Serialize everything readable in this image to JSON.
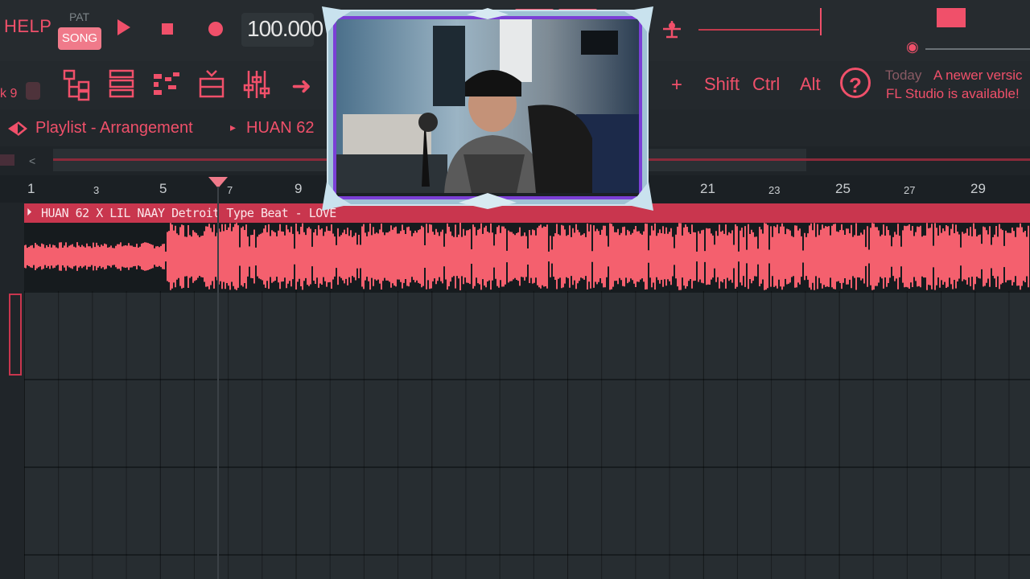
{
  "transport": {
    "help_label": "HELP",
    "pat_label": "PAT",
    "song_label": "SONG",
    "tempo": "100.000",
    "accent_color": "#f0506a"
  },
  "toolbar": {
    "pattern_num": "k 9",
    "shift_label": "Shift",
    "ctrl_label": "Ctrl",
    "alt_label": "Alt",
    "plus_label": "+",
    "icons": [
      "playlist-icon",
      "channel-rack-icon",
      "piano-roll-icon",
      "browser-icon",
      "mixer-icon",
      "arrow-icon",
      "help-icon"
    ]
  },
  "news": {
    "date": "Today",
    "line1": "A newer versic",
    "line2": "FL Studio is available!"
  },
  "playlist": {
    "title": "Playlist - Arrangement",
    "separator": "▸",
    "name": "HUAN 62"
  },
  "ruler": {
    "bars": [
      {
        "n": "1",
        "major": true
      },
      {
        "n": "3",
        "major": false
      },
      {
        "n": "5",
        "major": true
      },
      {
        "n": "7",
        "major": false
      },
      {
        "n": "9",
        "major": true
      },
      {
        "n": "21",
        "major": true
      },
      {
        "n": "23",
        "major": false
      },
      {
        "n": "25",
        "major": true
      },
      {
        "n": "27",
        "major": false
      },
      {
        "n": "29",
        "major": true
      }
    ]
  },
  "clip": {
    "title": "HUAN 62 X LIL NAAY Detroit Type Beat - LOVE",
    "color": "#c9364e",
    "wave_color": "#f4606e"
  }
}
